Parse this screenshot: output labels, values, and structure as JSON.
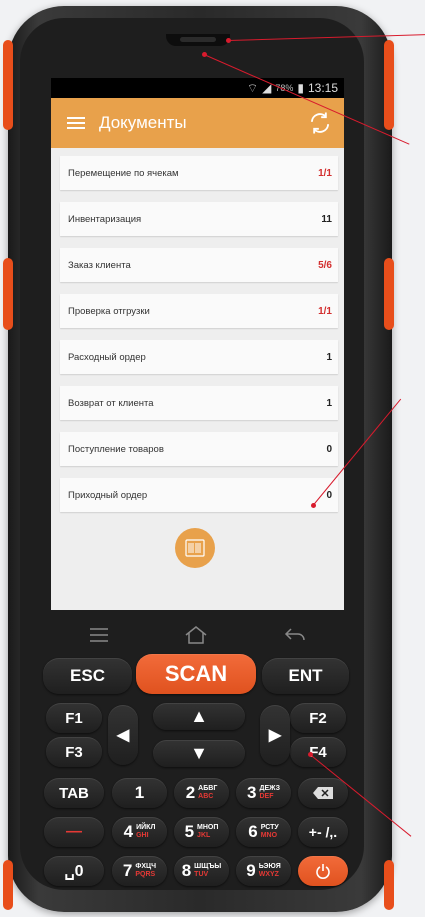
{
  "status": {
    "battery": "78%",
    "time": "13:15"
  },
  "app": {
    "title": "Документы"
  },
  "documents": [
    {
      "label": "Перемещение по ячекам",
      "count": "1/1",
      "color": "#d32f2f"
    },
    {
      "label": "Инвентаризация",
      "count": "11",
      "color": "#222222"
    },
    {
      "label": "Заказ клиента",
      "count": "5/6",
      "color": "#d32f2f"
    },
    {
      "label": "Проверка отгрузки",
      "count": "1/1",
      "color": "#d32f2f"
    },
    {
      "label": "Расходный ордер",
      "count": "1",
      "color": "#222222"
    },
    {
      "label": "Возврат от клиента",
      "count": "1",
      "color": "#222222"
    },
    {
      "label": "Поступление товаров",
      "count": "0",
      "color": "#222222"
    },
    {
      "label": "Приходный ордер",
      "count": "0",
      "color": "#222222"
    }
  ],
  "keys": {
    "esc": "ESC",
    "scan": "SCAN",
    "ent": "ENT",
    "f1": "F1",
    "f2": "F2",
    "f3": "F3",
    "f4": "F4",
    "tab": "TAB",
    "up": "▲",
    "down": "▼",
    "left": "◀",
    "right": "▶",
    "minus": "—",
    "plusminus": "+- /,.",
    "space0": "␣0",
    "del_icon": "backspace-icon",
    "power_icon": "power-icon",
    "d1": "1",
    "d2": "2",
    "d2ru": "АБВГ",
    "d2en": "ABC",
    "d3": "3",
    "d3ru": "ДЕЖЗ",
    "d3en": "DEF",
    "d4": "4",
    "d4ru": "ИЙКЛ",
    "d4en": "GHI",
    "d5": "5",
    "d5ru": "МНОП",
    "d5en": "JKL",
    "d6": "6",
    "d6ru": "РСТУ",
    "d6en": "MNO",
    "d7": "7",
    "d7ru": "ФХЦЧ",
    "d7en": "PQRS",
    "d8": "8",
    "d8ru": "ШЩЪЫ",
    "d8en": "TUV",
    "d9": "9",
    "d9ru": "ЬЭЮЯ",
    "d9en": "WXYZ"
  },
  "colors": {
    "accent": "#e8a14b",
    "scan": "#f26b3a",
    "callout": "#d81b2d"
  }
}
